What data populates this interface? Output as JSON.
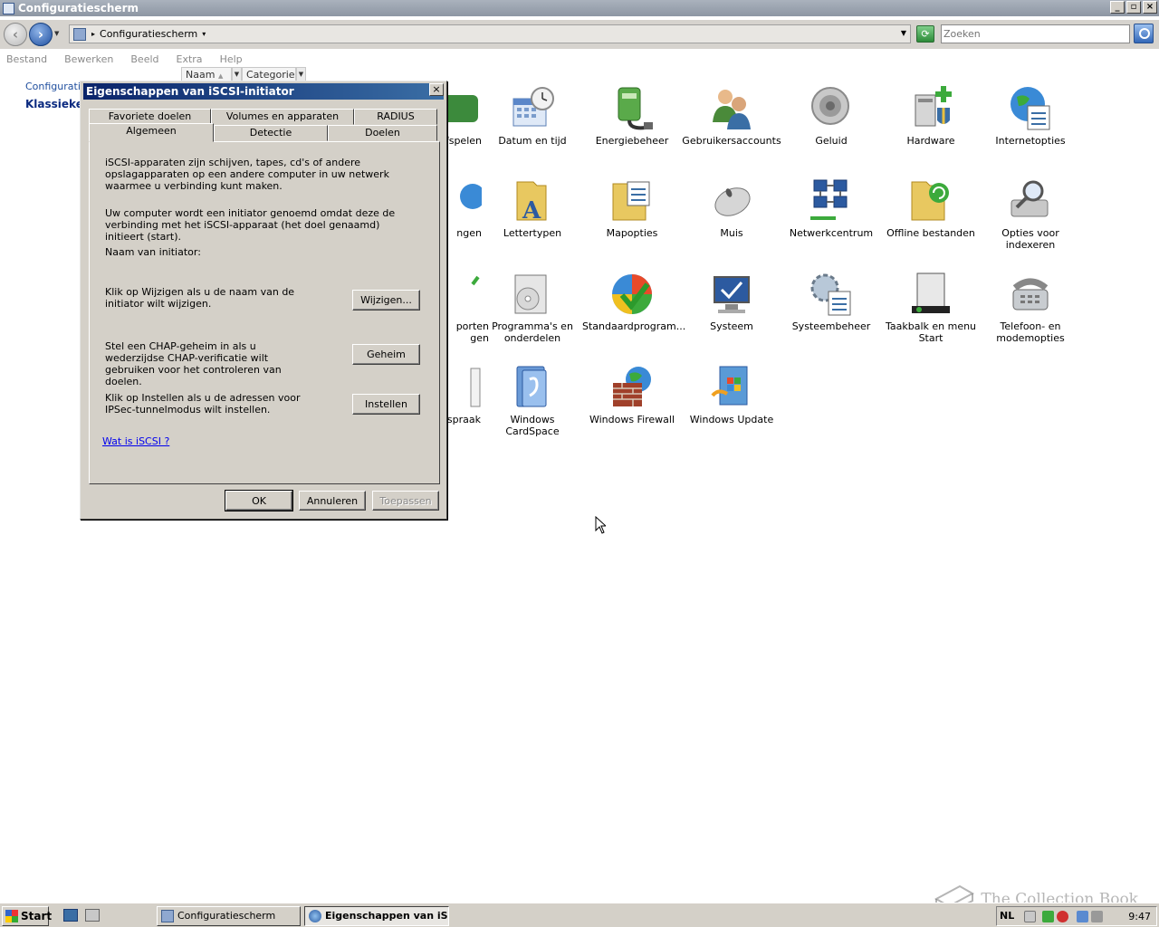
{
  "window": {
    "title": "Configuratiescherm"
  },
  "address": {
    "path": "Configuratiescherm",
    "search_placeholder": "Zoeken"
  },
  "menu": [
    "Bestand",
    "Bewerken",
    "Beeld",
    "Extra",
    "Help"
  ],
  "columns": {
    "name": "Naam",
    "category": "Categorie"
  },
  "leftnav": {
    "crumb": "Configuratie",
    "classic": "Klassieke w"
  },
  "items": [
    {
      "label": "fspelen",
      "icon": "game-controllers-icon"
    },
    {
      "label": "Datum en tijd",
      "icon": "calendar-clock-icon"
    },
    {
      "label": "Energiebeheer",
      "icon": "power-plug-icon"
    },
    {
      "label": "Gebruikersaccounts",
      "icon": "users-icon"
    },
    {
      "label": "Geluid",
      "icon": "speaker-icon"
    },
    {
      "label": "Hardware",
      "icon": "hardware-icon"
    },
    {
      "label": "Internetopties",
      "icon": "globe-document-icon"
    },
    {
      "label": "ngen",
      "icon": "globe-icon"
    },
    {
      "label": "Lettertypen",
      "icon": "fonts-folder-icon"
    },
    {
      "label": "Mapopties",
      "icon": "folder-options-icon"
    },
    {
      "label": "Muis",
      "icon": "mouse-icon"
    },
    {
      "label": "Netwerkcentrum",
      "icon": "network-icon"
    },
    {
      "label": "Offline bestanden",
      "icon": "offline-folder-icon"
    },
    {
      "label": "Opties voor indexeren",
      "icon": "indexing-icon"
    },
    {
      "label": "porten\ngen",
      "icon": "checkmark-icon"
    },
    {
      "label": "Programma's en onderdelen",
      "icon": "programs-icon"
    },
    {
      "label": "Standaardprogram...",
      "icon": "default-programs-icon"
    },
    {
      "label": "Systeem",
      "icon": "computer-icon"
    },
    {
      "label": "Systeembeheer",
      "icon": "admin-tools-icon"
    },
    {
      "label": "Taakbalk en menu Start",
      "icon": "taskbar-icon"
    },
    {
      "label": "Telefoon- en modemopties",
      "icon": "phone-icon"
    },
    {
      "label": "r spraak",
      "icon": "speech-icon"
    },
    {
      "label": "Windows CardSpace",
      "icon": "cardspace-icon"
    },
    {
      "label": "Windows Firewall",
      "icon": "firewall-icon"
    },
    {
      "label": "Windows Update",
      "icon": "windows-update-icon"
    }
  ],
  "dialog": {
    "title": "Eigenschappen van iSCSI-initiator",
    "tabs_back": [
      "Favoriete doelen",
      "Volumes en apparaten",
      "RADIUS"
    ],
    "tabs_front": [
      "Algemeen",
      "Detectie",
      "Doelen"
    ],
    "active_tab": "Algemeen",
    "para1": "iSCSI-apparaten zijn schijven, tapes, cd's of andere opslagapparaten op een andere computer in uw netwerk waarmee u verbinding kunt maken.",
    "para2": "Uw computer wordt een initiator genoemd omdat deze de verbinding met het iSCSI-apparaat (het doel genaamd) initieert (start).",
    "initiator_label": "Naam van initiator:",
    "change_text": "Klik op Wijzigen als u de naam van de initiator wilt wijzigen.",
    "change_button": "Wijzigen...",
    "chap_text": "Stel een CHAP-geheim in als u wederzijdse CHAP-verificatie wilt gebruiken voor het controleren van doelen.",
    "chap_button": "Geheim",
    "ipsec_text": "Klik op Instellen als u de adressen voor IPSec-tunnelmodus wilt instellen.",
    "ipsec_button": "Instellen",
    "link": "Wat is iSCSI ?",
    "ok": "OK",
    "cancel": "Annuleren",
    "apply": "Toepassen"
  },
  "taskbar": {
    "start": "Start",
    "tasks": [
      "Configuratiescherm",
      "Eigenschappen van iS..."
    ],
    "language": "NL",
    "time": "9:47"
  },
  "watermark": "The Collection Book"
}
